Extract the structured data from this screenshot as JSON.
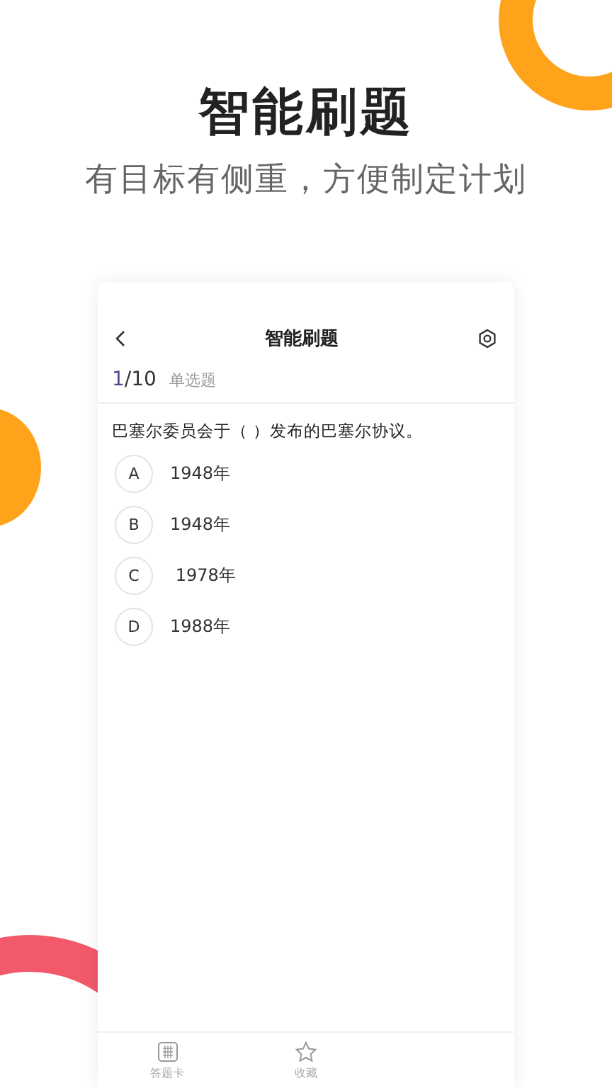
{
  "headline": "智能刷题",
  "subtitle": "有目标有侧重，方便制定计划",
  "app": {
    "title": "智能刷题",
    "progress_current": "1",
    "progress_total": "/10",
    "question_type": "单选题",
    "question": "巴塞尔委员会于（ ）发布的巴塞尔协议。",
    "options": [
      {
        "letter": "A",
        "text": "1948年"
      },
      {
        "letter": "B",
        "text": "1948年"
      },
      {
        "letter": "C",
        "text": " 1978年"
      },
      {
        "letter": "D",
        "text": "1988年"
      }
    ],
    "tabs": [
      {
        "kind": "grid",
        "label": "答题卡"
      },
      {
        "kind": "star",
        "label": "收藏"
      }
    ]
  }
}
